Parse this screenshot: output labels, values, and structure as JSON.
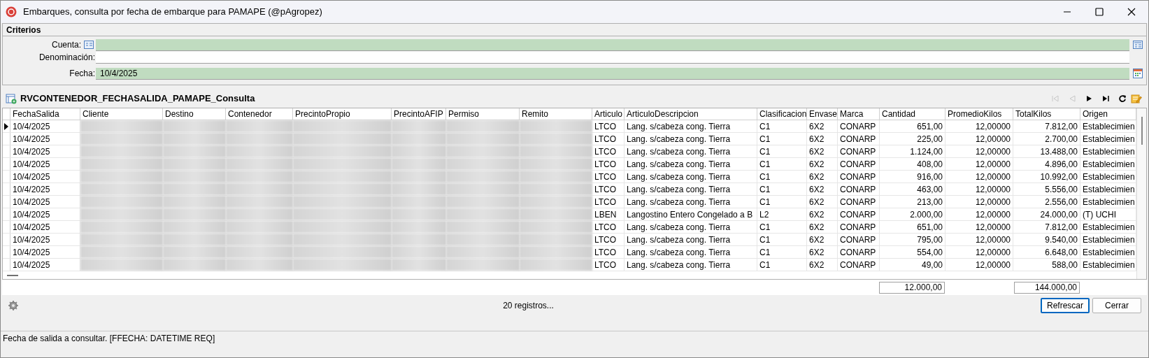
{
  "window": {
    "title": "Embarques, consulta por fecha de embarque para PAMAPE (@pAgropez)"
  },
  "criteria": {
    "title": "Criterios",
    "fields": [
      {
        "label": "Cuenta:",
        "kind": "lookup",
        "required": true
      },
      {
        "label": "Denominación:",
        "kind": "text",
        "required": false
      },
      {
        "label": "Fecha:",
        "value": "10/4/2025",
        "kind": "date",
        "required": true
      }
    ]
  },
  "grid": {
    "title": "RVCONTENEDOR_FECHASALIDA_PAMAPE_Consulta",
    "columns": [
      "FechaSalida",
      "Cliente",
      "Destino",
      "Contenedor",
      "PrecintoPropio",
      "PrecintoAFIP",
      "Permiso",
      "Remito",
      "Articulo",
      "ArticuloDescripcion",
      "Clasificacion",
      "Envase",
      "Marca",
      "Cantidad",
      "PromedioKilos",
      "TotalKilos",
      "Origen"
    ],
    "rows": [
      {
        "current": true,
        "cells": [
          "10/4/2025",
          null,
          null,
          null,
          null,
          null,
          null,
          null,
          "LTCO",
          "Lang. s/cabeza cong. Tierra",
          "C1",
          "6X2",
          "CONARP",
          "651,00",
          "12,00000",
          "7.812,00",
          "Establecimien"
        ]
      },
      {
        "current": false,
        "cells": [
          "10/4/2025",
          null,
          null,
          null,
          null,
          null,
          null,
          null,
          "LTCO",
          "Lang. s/cabeza cong. Tierra",
          "C1",
          "6X2",
          "CONARP",
          "225,00",
          "12,00000",
          "2.700,00",
          "Establecimien"
        ]
      },
      {
        "current": false,
        "cells": [
          "10/4/2025",
          null,
          null,
          null,
          null,
          null,
          null,
          null,
          "LTCO",
          "Lang. s/cabeza cong. Tierra",
          "C1",
          "6X2",
          "CONARP",
          "1.124,00",
          "12,00000",
          "13.488,00",
          "Establecimien"
        ]
      },
      {
        "current": false,
        "cells": [
          "10/4/2025",
          null,
          null,
          null,
          null,
          null,
          null,
          null,
          "LTCO",
          "Lang. s/cabeza cong. Tierra",
          "C1",
          "6X2",
          "CONARP",
          "408,00",
          "12,00000",
          "4.896,00",
          "Establecimien"
        ]
      },
      {
        "current": false,
        "cells": [
          "10/4/2025",
          null,
          null,
          null,
          null,
          null,
          null,
          null,
          "LTCO",
          "Lang. s/cabeza cong. Tierra",
          "C1",
          "6X2",
          "CONARP",
          "916,00",
          "12,00000",
          "10.992,00",
          "Establecimien"
        ]
      },
      {
        "current": false,
        "cells": [
          "10/4/2025",
          null,
          null,
          null,
          null,
          null,
          null,
          null,
          "LTCO",
          "Lang. s/cabeza cong. Tierra",
          "C1",
          "6X2",
          "CONARP",
          "463,00",
          "12,00000",
          "5.556,00",
          "Establecimien"
        ]
      },
      {
        "current": false,
        "cells": [
          "10/4/2025",
          null,
          null,
          null,
          null,
          null,
          null,
          null,
          "LTCO",
          "Lang. s/cabeza cong. Tierra",
          "C1",
          "6X2",
          "CONARP",
          "213,00",
          "12,00000",
          "2.556,00",
          "Establecimien"
        ]
      },
      {
        "current": false,
        "cells": [
          "10/4/2025",
          null,
          null,
          null,
          null,
          null,
          null,
          null,
          "LBEN",
          "Langostino Entero Congelado a B",
          "L2",
          "6X2",
          "CONARP",
          "2.000,00",
          "12,00000",
          "24.000,00",
          "(T) UCHI"
        ]
      },
      {
        "current": false,
        "cells": [
          "10/4/2025",
          null,
          null,
          null,
          null,
          null,
          null,
          null,
          "LTCO",
          "Lang. s/cabeza cong. Tierra",
          "C1",
          "6X2",
          "CONARP",
          "651,00",
          "12,00000",
          "7.812,00",
          "Establecimien"
        ]
      },
      {
        "current": false,
        "cells": [
          "10/4/2025",
          null,
          null,
          null,
          null,
          null,
          null,
          null,
          "LTCO",
          "Lang. s/cabeza cong. Tierra",
          "C1",
          "6X2",
          "CONARP",
          "795,00",
          "12,00000",
          "9.540,00",
          "Establecimien"
        ]
      },
      {
        "current": false,
        "cells": [
          "10/4/2025",
          null,
          null,
          null,
          null,
          null,
          null,
          null,
          "LTCO",
          "Lang. s/cabeza cong. Tierra",
          "C1",
          "6X2",
          "CONARP",
          "554,00",
          "12,00000",
          "6.648,00",
          "Establecimien"
        ]
      },
      {
        "current": false,
        "cells": [
          "10/4/2025",
          null,
          null,
          null,
          null,
          null,
          null,
          null,
          "LTCO",
          "Lang. s/cabeza cong. Tierra",
          "C1",
          "6X2",
          "CONARP",
          "49,00",
          "12,00000",
          "588,00",
          "Establecimien"
        ]
      }
    ],
    "totals": {
      "cantidad": "12.000,00",
      "total_kilos": "144.000,00"
    }
  },
  "footer": {
    "record_count": "20 registros...",
    "buttons": [
      {
        "label": "Refrescar",
        "focused": true
      },
      {
        "label": "Cerrar",
        "focused": false
      }
    ]
  },
  "status_bar": "Fecha de salida a consultar. [FFECHA: DATETIME REQ]"
}
